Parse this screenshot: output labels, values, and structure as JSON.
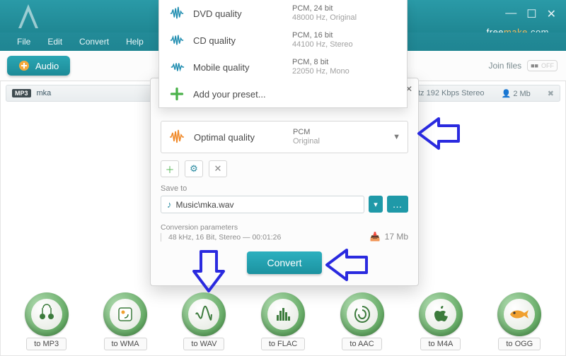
{
  "menu": {
    "file": "File",
    "edit": "Edit",
    "convert": "Convert",
    "help": "Help"
  },
  "brand": {
    "free": "free",
    "make": "make",
    "com": ".com"
  },
  "toolbar": {
    "audio": "Audio",
    "join": "Join files"
  },
  "filerow": {
    "badge": "MP3",
    "name": "mka",
    "codec_bitrate": "tz  192 Kbps  Stereo",
    "size": "2 Mb"
  },
  "presets": [
    {
      "name": "DVD quality",
      "line1": "PCM, 24 bit",
      "line2": "48000 Hz,  Original"
    },
    {
      "name": "CD quality",
      "line1": "PCM, 16 bit",
      "line2": "44100 Hz,  Stereo"
    },
    {
      "name": "Mobile quality",
      "line1": "PCM, 8 bit",
      "line2": "22050 Hz,  Mono"
    }
  ],
  "add_preset": "Add your preset...",
  "selected": {
    "name": "Optimal quality",
    "line1": "PCM",
    "line2": "Original"
  },
  "modal": {
    "save_label": "Save to",
    "save_path": "Music\\mka.wav",
    "conv_label": "Conversion parameters",
    "conv_value": "48 kHz, 16 Bit, Stereo — 00:01:26",
    "size": "17 Mb",
    "convert": "Convert"
  },
  "targets": [
    {
      "label": "to MP3"
    },
    {
      "label": "to WMA"
    },
    {
      "label": "to WAV"
    },
    {
      "label": "to FLAC"
    },
    {
      "label": "to AAC"
    },
    {
      "label": "to M4A"
    },
    {
      "label": "to OGG"
    }
  ]
}
